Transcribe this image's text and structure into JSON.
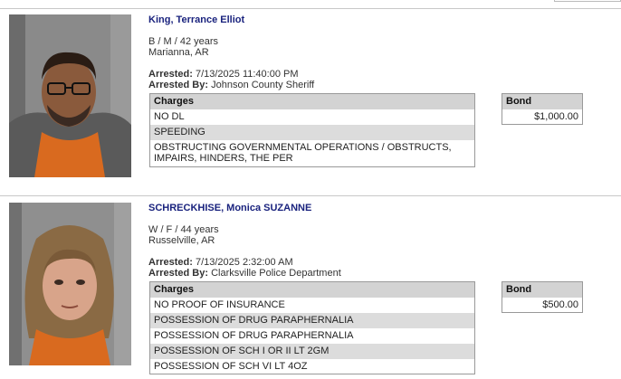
{
  "records": [
    {
      "name": "King, Terrance Elliot",
      "demographics": "B / M / 42 years",
      "location": "Marianna, AR",
      "arrested_label": "Arrested:",
      "arrested_value": "7/13/2025 11:40:00 PM",
      "arrested_by_label": "Arrested By:",
      "arrested_by_value": "Johnson County Sheriff",
      "charges_header": "Charges",
      "charges": [
        "NO DL",
        "SPEEDING",
        "OBSTRUCTING GOVERNMENTAL OPERATIONS / OBSTRUCTS, IMPAIRS, HINDERS, THE PER"
      ],
      "bond_header": "Bond",
      "bond": "$1,000.00"
    },
    {
      "name": "SCHRECKHISE, Monica SUZANNE",
      "demographics": "W / F / 44 years",
      "location": "Russelville, AR",
      "arrested_label": "Arrested:",
      "arrested_value": "7/13/2025 2:32:00 AM",
      "arrested_by_label": "Arrested By:",
      "arrested_by_value": "Clarksville Police Department",
      "charges_header": "Charges",
      "charges": [
        "NO PROOF OF INSURANCE",
        "POSSESSION OF DRUG PARAPHERNALIA",
        "POSSESSION OF DRUG PARAPHERNALIA",
        "POSSESSION OF SCH I OR II LT 2GM",
        "POSSESSION OF SCH VI LT 4OZ"
      ],
      "bond_header": "Bond",
      "bond": "$500.00"
    }
  ]
}
